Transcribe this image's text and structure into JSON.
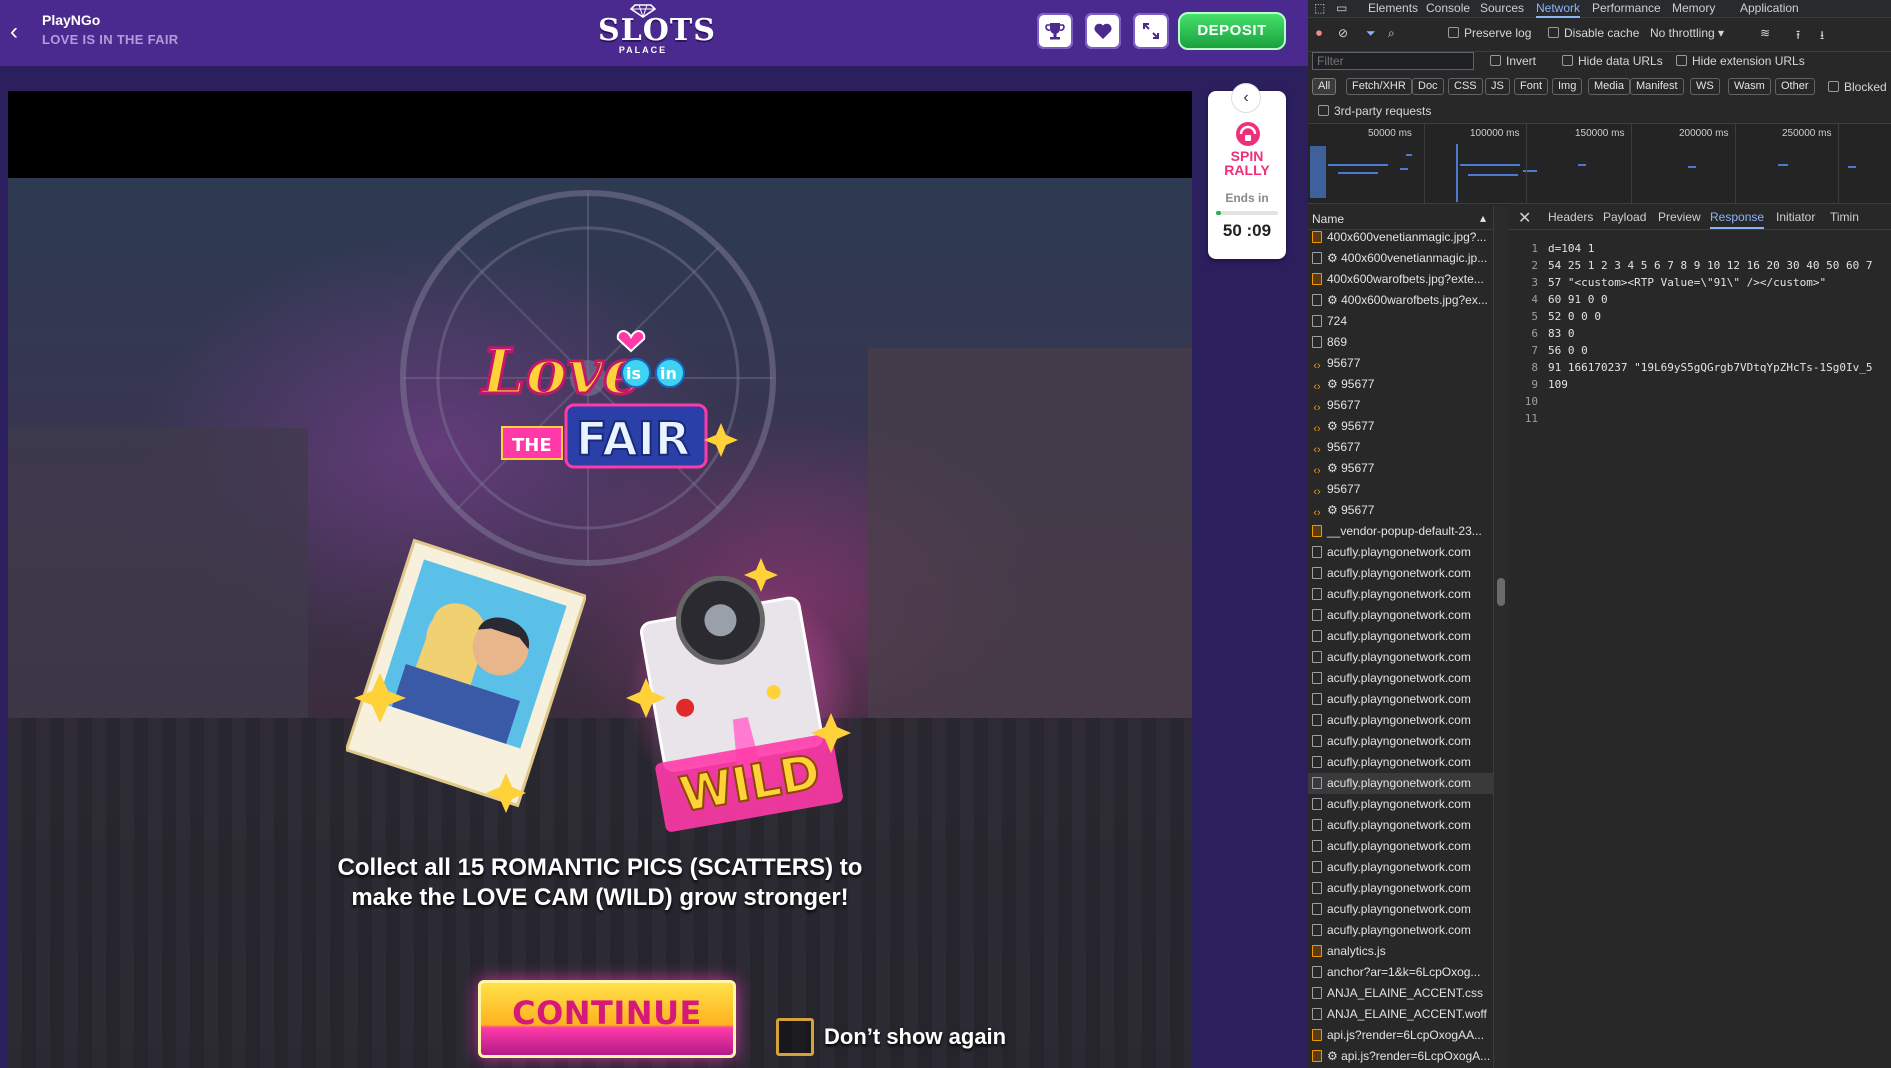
{
  "site": {
    "provider": "PlayNGo",
    "game_title": "LOVE IS IN THE FAIR",
    "logo_main": "SLOTS",
    "logo_sub": "PALACE",
    "deposit_label": "DEPOSIT",
    "icons": [
      "trophy-icon",
      "heart-icon",
      "expand-icon"
    ]
  },
  "game": {
    "logo_love": "Love",
    "logo_is": "is",
    "logo_in": "in",
    "logo_the": "THE",
    "logo_fair": "FAIR",
    "wild_text": "WILD",
    "instruction_line1": "Collect all 15 ROMANTIC PICS (SCATTERS) to",
    "instruction_line2": "make the LOVE CAM (WILD) grow stronger!",
    "continue_label": "CONTINUE",
    "dont_show_label": "Don’t show again"
  },
  "rally": {
    "title_line1": "SPIN",
    "title_line2": "RALLY",
    "ends_label": "Ends in",
    "timer": "50 :09",
    "progress": 0.08
  },
  "devtools": {
    "tabs": [
      "Elements",
      "Console",
      "Sources",
      "Network",
      "Performance",
      "Memory",
      "Application"
    ],
    "active_tab": "Network",
    "toolbar": {
      "preserve_log": "Preserve log",
      "disable_cache": "Disable cache",
      "throttling": "No throttling"
    },
    "filter_placeholder": "Filter",
    "filter_options": {
      "invert": "Invert",
      "hide_data": "Hide data URLs",
      "hide_ext": "Hide extension URLs"
    },
    "type_filters": [
      "All",
      "Fetch/XHR",
      "Doc",
      "CSS",
      "JS",
      "Font",
      "Img",
      "Media",
      "Manifest",
      "WS",
      "Wasm",
      "Other"
    ],
    "blocked": "Blocked",
    "third_party": "3rd-party requests",
    "overview_labels": [
      "50000 ms",
      "100000 ms",
      "150000 ms",
      "200000 ms",
      "250000 ms"
    ],
    "list_header": "Name",
    "requests": [
      {
        "name": "400x600venetianmagic.jpg?...",
        "type": "img"
      },
      {
        "name": "⚙ 400x600venetianmagic.jp...",
        "type": "doc"
      },
      {
        "name": "400x600warofbets.jpg?exte...",
        "type": "img"
      },
      {
        "name": "⚙ 400x600warofbets.jpg?ex...",
        "type": "doc"
      },
      {
        "name": "724",
        "type": "doc"
      },
      {
        "name": "869",
        "type": "doc"
      },
      {
        "name": "95677",
        "type": "xhr"
      },
      {
        "name": "⚙ 95677",
        "type": "xhr"
      },
      {
        "name": "95677",
        "type": "xhr"
      },
      {
        "name": "⚙ 95677",
        "type": "xhr"
      },
      {
        "name": "95677",
        "type": "xhr"
      },
      {
        "name": "⚙ 95677",
        "type": "xhr"
      },
      {
        "name": "95677",
        "type": "xhr"
      },
      {
        "name": "⚙ 95677",
        "type": "xhr"
      },
      {
        "name": "__vendor-popup-default-23...",
        "type": "img"
      },
      {
        "name": "acufly.playngonetwork.com",
        "type": "doc"
      },
      {
        "name": "acufly.playngonetwork.com",
        "type": "doc"
      },
      {
        "name": "acufly.playngonetwork.com",
        "type": "doc"
      },
      {
        "name": "acufly.playngonetwork.com",
        "type": "doc"
      },
      {
        "name": "acufly.playngonetwork.com",
        "type": "doc"
      },
      {
        "name": "acufly.playngonetwork.com",
        "type": "doc"
      },
      {
        "name": "acufly.playngonetwork.com",
        "type": "doc"
      },
      {
        "name": "acufly.playngonetwork.com",
        "type": "doc"
      },
      {
        "name": "acufly.playngonetwork.com",
        "type": "doc"
      },
      {
        "name": "acufly.playngonetwork.com",
        "type": "doc"
      },
      {
        "name": "acufly.playngonetwork.com",
        "type": "doc"
      },
      {
        "name": "acufly.playngonetwork.com",
        "type": "sel"
      },
      {
        "name": "acufly.playngonetwork.com",
        "type": "doc"
      },
      {
        "name": "acufly.playngonetwork.com",
        "type": "doc"
      },
      {
        "name": "acufly.playngonetwork.com",
        "type": "doc"
      },
      {
        "name": "acufly.playngonetwork.com",
        "type": "doc"
      },
      {
        "name": "acufly.playngonetwork.com",
        "type": "doc"
      },
      {
        "name": "acufly.playngonetwork.com",
        "type": "doc"
      },
      {
        "name": "acufly.playngonetwork.com",
        "type": "doc"
      },
      {
        "name": "analytics.js",
        "type": "img"
      },
      {
        "name": "anchor?ar=1&k=6LcpOxog...",
        "type": "doc"
      },
      {
        "name": "ANJA_ELAINE_ACCENT.css",
        "type": "doc"
      },
      {
        "name": "ANJA_ELAINE_ACCENT.woff",
        "type": "doc"
      },
      {
        "name": "api.js?render=6LcpOxogAA...",
        "type": "img"
      },
      {
        "name": "⚙ api.js?render=6LcpOxogA...",
        "type": "img"
      }
    ],
    "detail_tabs": [
      "Headers",
      "Payload",
      "Preview",
      "Response",
      "Initiator",
      "Timin"
    ],
    "active_detail_tab": "Response",
    "response_lines": [
      "d=104 1",
      "54 25 1 2 3 4 5 6 7 8 9 10 12 16 20 30 40 50 60 7",
      "57 \"<custom><RTP Value=\\\"91\\\" /></custom>\"",
      "60 91 0 0",
      "52 0 0 0",
      "83 0",
      "56 0 0",
      "91 166170237 \"19L69yS5gQGrgb7VDtqYpZHcTs-1Sg0Iv_5",
      "109",
      "",
      ""
    ]
  },
  "colors": {
    "header_purple": "#4b2a8f",
    "deposit_green": "#1aa13f",
    "devtools_accent": "#8ab4f8"
  }
}
